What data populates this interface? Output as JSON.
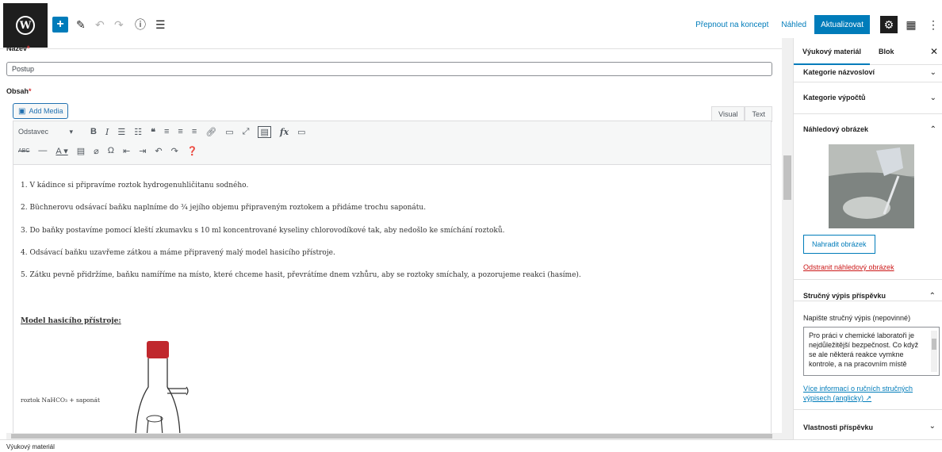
{
  "toolbar": {
    "switch_to_draft": "Přepnout na koncept",
    "preview": "Náhled",
    "update": "Aktualizovat"
  },
  "form": {
    "title_label": "Název",
    "title_value": "Postup",
    "content_label": "Obsah",
    "required_mark": "*",
    "add_media": "Add Media",
    "tab_visual": "Visual",
    "tab_text": "Text",
    "format_select": "Odstavec"
  },
  "content": {
    "steps": [
      "1. V kádince si připravíme roztok hydrogenuhličitanu sodného.",
      "2. Büchnerovu odsávací baňku naplníme do ¾ jejího objemu připraveným roztokem a přidáme trochu saponátu.",
      "3. Do baňky postavíme pomocí kleští zkumavku s 10 ml koncentrované kyseliny chlorovodíkové tak, aby nedošlo ke smíchání roztoků.",
      "4. Odsávací baňku uzavřeme zátkou a máme připravený malý model hasicího přístroje.",
      "5. Zátku pevně přidržíme, baňku namíříme na místo, které chceme hasit, převrátíme dnem vzhůru, aby se roztoky smíchaly, a pozorujeme reakci (hasíme)."
    ],
    "model_title": "Model hasicího přístroje:",
    "figure_caption": "roztok NaHCO₃ + saponát"
  },
  "sidebar": {
    "tab_post": "Výukový materiál",
    "tab_block": "Blok",
    "panels": {
      "naming": "Kategorie názvosloví",
      "calc": "Kategorie výpočtů",
      "featured": "Náhledový obrázek",
      "excerpt": "Stručný výpis příspěvku",
      "properties": "Vlastnosti příspěvku"
    },
    "replace_image": "Nahradit obrázek",
    "remove_image": "Odstranit náhledový obrázek",
    "excerpt_hint": "Napište stručný výpis (nepovinné)",
    "excerpt_text": "Pro práci v chemické laboratoři je nejdůležitější bezpečnost. Co když se ale některá reakce vymkne kontrole, a na pracovním místě",
    "more_info": "Více informací o ručních stručných výpisech (anglicky)"
  },
  "status": {
    "breadcrumb": "Výukový materiál"
  },
  "colors": {
    "accent": "#007cba",
    "danger": "#cc1818",
    "cap": "#c0282d"
  }
}
